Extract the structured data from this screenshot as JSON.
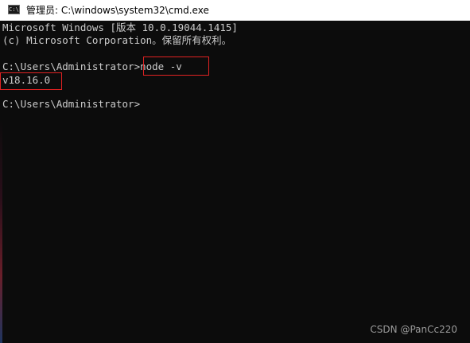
{
  "window": {
    "title": "管理员: C:\\windows\\system32\\cmd.exe",
    "icon": "cmd-icon",
    "icon_glyph": "C:\\"
  },
  "console": {
    "lines": [
      "Microsoft Windows [版本 10.0.19044.1415]",
      "(c) Microsoft Corporation。保留所有权利。",
      "",
      "C:\\Users\\Administrator>node -v",
      "v18.16.0",
      "",
      "C:\\Users\\Administrator>"
    ],
    "highlights": [
      "node -v",
      "v18.16.0"
    ]
  },
  "watermark": "CSDN @PanCc220",
  "colors": {
    "background": "#0c0c0c",
    "text": "#cccccc",
    "highlight_border": "#e02222",
    "titlebar": "#ffffff"
  }
}
